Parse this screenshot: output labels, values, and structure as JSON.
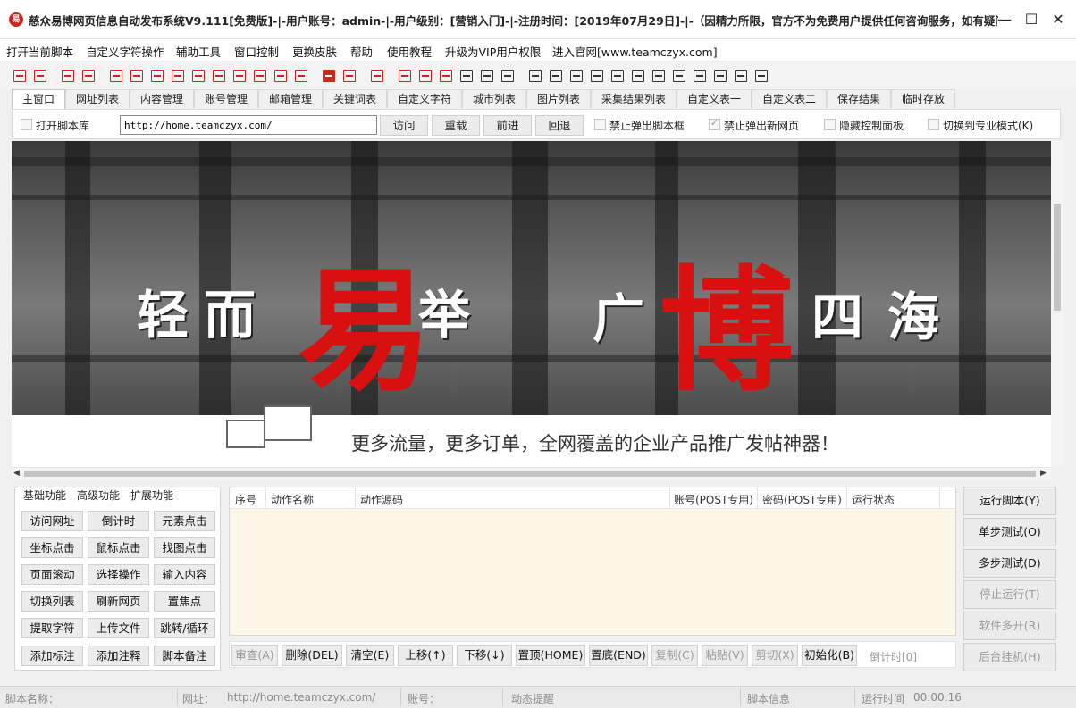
{
  "window": {
    "title": "慈众易博网页信息自动发布系统V9.111[免费版]-|-用户账号：admin-|-用户级别：[营销入门]-|-注册时间：[2019年07月29日]-|-（因精力所限，官方不为免费用户提供任何咨询服务，如有疑问请至论坛...",
    "logo_text": "易",
    "minimize": "—",
    "maximize": "☐",
    "close": "✕"
  },
  "menu": [
    "打开当前脚本",
    "自定义字符操作",
    "辅助工具",
    "窗口控制",
    "更换皮肤",
    "帮助",
    "使用教程",
    "升级为VIP用户权限",
    "进入官网[www.teamczyx.com]"
  ],
  "tabs": [
    "主窗口",
    "网址列表",
    "内容管理",
    "账号管理",
    "邮箱管理",
    "关键词表",
    "自定义字符",
    "城市列表",
    "图片列表",
    "采集结果列表",
    "自定义表一",
    "自定义表二",
    "保存结果",
    "临时存放"
  ],
  "navbar": {
    "open_library_label": "打开脚本库",
    "url_value": "http://home.teamczyx.com/",
    "visit": "访问",
    "reload": "重载",
    "forward": "前进",
    "back": "回退",
    "block_script_popup": "禁止弹出脚本框",
    "block_new_page": "禁止弹出新网页",
    "hide_control_panel": "隐藏控制面板",
    "pro_mode": "切换到专业模式(K)"
  },
  "banner": {
    "slogan_chars": [
      "轻",
      "而",
      "易",
      "举",
      "广",
      "博",
      "四",
      "海"
    ],
    "tagline": "更多流量，更多订单，全网覆盖的企业产品推广发帖神器！"
  },
  "left_panel": {
    "tabs": [
      "基础功能",
      "高级功能",
      "扩展功能"
    ],
    "buttons": [
      "访问网址",
      "倒计时",
      "元素点击",
      "坐标点击",
      "鼠标点击",
      "找图点击",
      "页面滚动",
      "选择操作",
      "输入内容",
      "切换列表",
      "刷新网页",
      "置焦点",
      "提取字符",
      "上传文件",
      "跳转/循环",
      "添加标注",
      "添加注释",
      "脚本备注"
    ]
  },
  "grid": {
    "columns": [
      "序号",
      "动作名称",
      "动作源码",
      "账号(POST专用)",
      "密码(POST专用)",
      "运行状态"
    ]
  },
  "actions": {
    "buttons": [
      {
        "label": "审查(A)",
        "disabled": true
      },
      {
        "label": "删除(DEL)",
        "disabled": false
      },
      {
        "label": "清空(E)",
        "disabled": false
      },
      {
        "label": "上移(↑)",
        "disabled": false
      },
      {
        "label": "下移(↓)",
        "disabled": false
      },
      {
        "label": "置顶(HOME)",
        "disabled": false
      },
      {
        "label": "置底(END)",
        "disabled": false
      },
      {
        "label": "复制(C)",
        "disabled": true
      },
      {
        "label": "粘贴(V)",
        "disabled": true
      },
      {
        "label": "剪切(X)",
        "disabled": true
      },
      {
        "label": "初始化(B)",
        "disabled": false
      }
    ],
    "timer": "倒计时[0]"
  },
  "right_panel": [
    {
      "label": "运行脚本(Y)",
      "disabled": false
    },
    {
      "label": "单步测试(O)",
      "disabled": false
    },
    {
      "label": "多步测试(D)",
      "disabled": false
    },
    {
      "label": "停止运行(T)",
      "disabled": true
    },
    {
      "label": "软件多开(R)",
      "disabled": true
    },
    {
      "label": "后台挂机(H)",
      "disabled": true
    }
  ],
  "status": {
    "script_name_label": "脚本名称：",
    "url_label": "网址：",
    "url_value": "http://home.teamczyx.com/",
    "account_label": "账号：",
    "dynamic_tip": "动态提醒",
    "script_info": "脚本信息",
    "run_time_label": "运行时间",
    "run_time_value": "00:00:16"
  },
  "colors": {
    "accent_red": "#d81010",
    "grid_bg": "#fdf7e8",
    "disabled_text": "#9a9a9a"
  }
}
